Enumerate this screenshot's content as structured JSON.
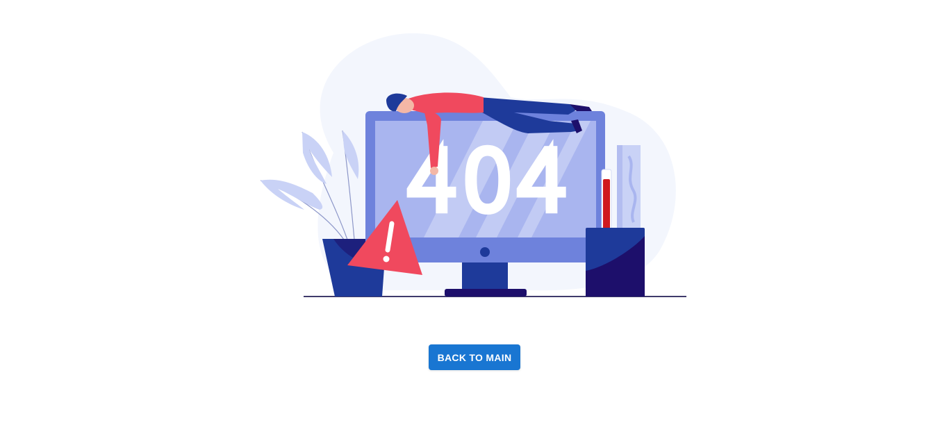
{
  "illustration": {
    "error_code": "404",
    "colors": {
      "blob": "#f3f6fd",
      "monitor_frame": "#6e82dc",
      "monitor_screen": "#a9b5ef",
      "dark_blue": "#1e3a9a",
      "navy": "#1d0f6b",
      "person_shirt": "#f0495e",
      "warning_red": "#f0495e",
      "plant_leaves": "#c9d2f6",
      "ground_line": "#3f3a6b"
    }
  },
  "actions": {
    "back_label": "BACK TO MAIN",
    "button_color": "#1976d2"
  }
}
